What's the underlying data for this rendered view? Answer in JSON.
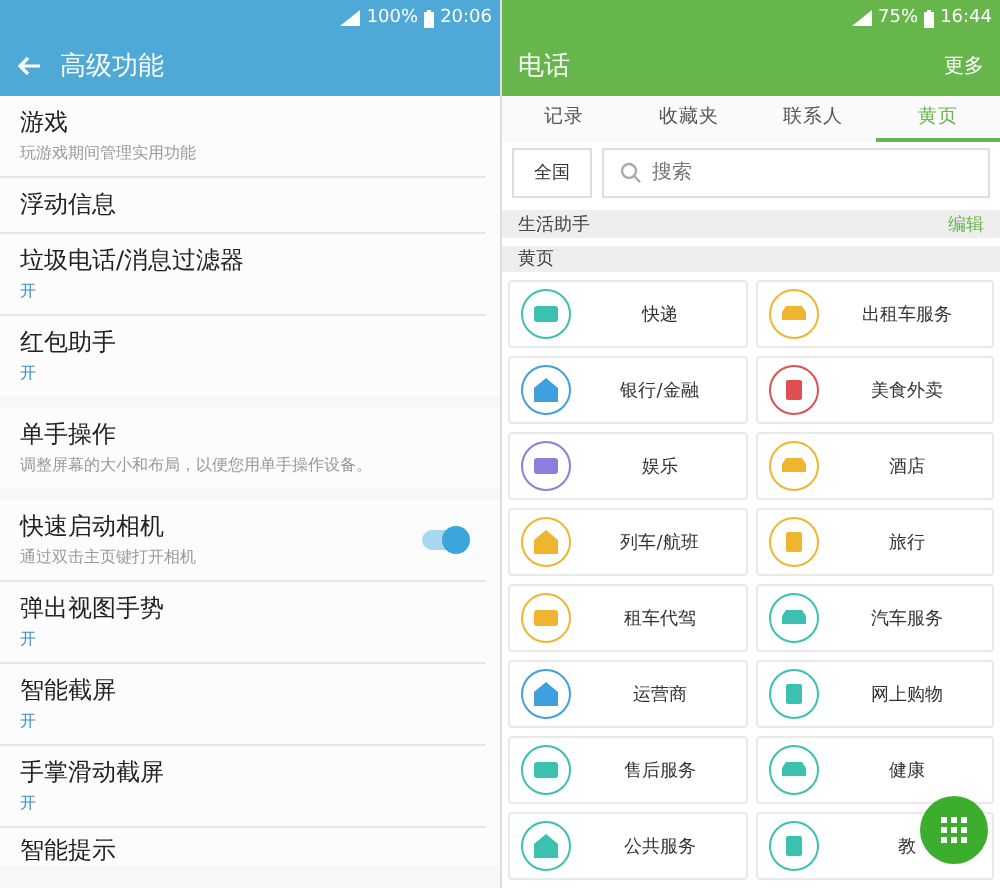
{
  "left": {
    "status_bar": {
      "battery": "100%",
      "time": "20:06"
    },
    "title": "高级功能",
    "groups": [
      [
        {
          "title": "游戏",
          "subtitle": "玩游戏期间管理实用功能",
          "kind": "desc"
        },
        {
          "title": "浮动信息"
        },
        {
          "title": "垃圾电话/消息过滤器",
          "subtitle": "开",
          "kind": "state"
        },
        {
          "title": "红包助手",
          "subtitle": "开",
          "kind": "state"
        }
      ],
      [
        {
          "title": "单手操作",
          "subtitle": "调整屏幕的大小和布局，以便您用单手操作设备。",
          "kind": "desc"
        }
      ],
      [
        {
          "title": "快速启动相机",
          "subtitle": "通过双击主页键打开相机",
          "kind": "desc",
          "toggle": true
        },
        {
          "title": "弹出视图手势",
          "subtitle": "开",
          "kind": "state"
        },
        {
          "title": "智能截屏",
          "subtitle": "开",
          "kind": "state"
        },
        {
          "title": "手掌滑动截屏",
          "subtitle": "开",
          "kind": "state"
        },
        {
          "title": "智能提示"
        }
      ]
    ]
  },
  "right": {
    "status_bar": {
      "battery": "75%",
      "time": "16:44"
    },
    "title": "电话",
    "more": "更多",
    "tabs": [
      {
        "label": "记录",
        "selected": false
      },
      {
        "label": "收藏夹",
        "selected": false
      },
      {
        "label": "联系人",
        "selected": false
      },
      {
        "label": "黄页",
        "selected": true
      }
    ],
    "region_button": "全国",
    "search": {
      "placeholder": "搜索"
    },
    "section": {
      "title": "生活助手",
      "action": "编辑"
    },
    "subsection": "黄页",
    "services": [
      {
        "label": "快递",
        "color": "#3cc0b0"
      },
      {
        "label": "出租车服务",
        "color": "#f0b530"
      },
      {
        "label": "银行/金融",
        "color": "#3fa0e0"
      },
      {
        "label": "美食外卖",
        "color": "#e05050"
      },
      {
        "label": "娱乐",
        "color": "#8a7ee0"
      },
      {
        "label": "酒店",
        "color": "#f0b530"
      },
      {
        "label": "列车/航班",
        "color": "#f0b530"
      },
      {
        "label": "旅行",
        "color": "#f0b530"
      },
      {
        "label": "租车代驾",
        "color": "#f0b530"
      },
      {
        "label": "汽车服务",
        "color": "#3cc0b0"
      },
      {
        "label": "运营商",
        "color": "#3fa0e0"
      },
      {
        "label": "网上购物",
        "color": "#3cc0b0"
      },
      {
        "label": "售后服务",
        "color": "#3cc0b0"
      },
      {
        "label": "健康",
        "color": "#3cc0b0"
      },
      {
        "label": "公共服务",
        "color": "#3cc0b0"
      },
      {
        "label": "教",
        "color": "#3cc0b0"
      }
    ]
  }
}
